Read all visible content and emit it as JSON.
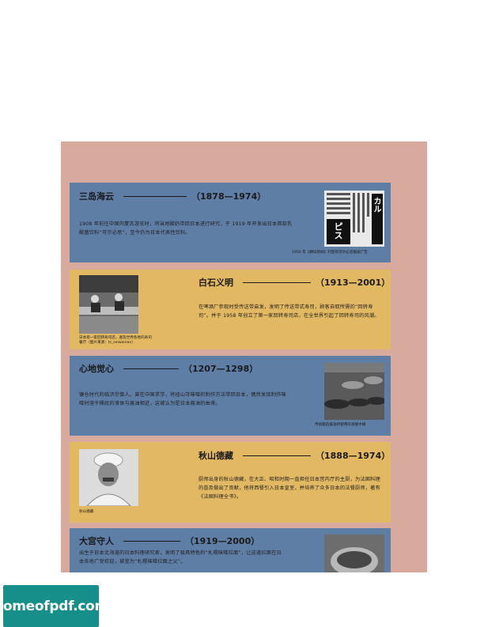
{
  "cards": [
    {
      "name": "三岛海云",
      "years": "（1878—1974）",
      "body": "1908 年前往中国内蒙古游览时，将当地酸奶带回日本进行研究，于 1919 年开发出日本首款乳酸菌饮料“可尔必思”，至今仍为日本代表性饮料。",
      "caption": "1950 年《朝日新闻》刊登的可尔必思报纸广告"
    },
    {
      "name": "白石义明",
      "years": "（1913—2001）",
      "body": "在啤酒厂参观时受传送带启发，发明了传送带式寿司，顾客自取所需的“回转寿司”。并于 1958 年创立了第一家回转寿司店，在全世界引起了回转寿司的风潮。",
      "caption": "日本第一家回转寿司店，遍及世界各地的寿司餐厅（图片来源：ts_seiwainan）"
    },
    {
      "name": "心地觉心",
      "years": "（1207—1298）",
      "body": "镰仓时代的临济宗僧人。曾在中国求学，将径山寺味噌的制作方法带回日本，偶然发现制作味噌时溶于桶底的液体与酱油相近，这被认为是日本酱油的由来。",
      "caption": "传统酿造酱油所使用的发酵木桶"
    },
    {
      "name": "秋山德藏",
      "years": "（1888—1974）",
      "body": "厨师出身的秋山德藏，在大正、昭和时期一直担任日本宫内厅的主厨，为法国料理的普及做出了贡献，他将西餐引入日本皇室，并培养了众多日本的法餐厨师，著有《法国料理全书》。",
      "caption": "秋山德藏"
    },
    {
      "name": "大宫守人",
      "years": "（1919—2000）",
      "body": "出生于日本北海道的日本料理研究家，发明了极具特色的“札幌味噌拉面”，让这道拉面在日本各地广受欢迎，被誉为“札幌味噌拉面之父”。",
      "caption": ""
    }
  ],
  "ad_text": {
    "left": "カル",
    "right": "ピス"
  },
  "watermark": "homeofpdf.com",
  "colors": {
    "page_bg": "#d8a99d",
    "blue_card": "#5f7ea6",
    "yellow_card": "#e2b862",
    "watermark_bg": "#168e8a"
  }
}
